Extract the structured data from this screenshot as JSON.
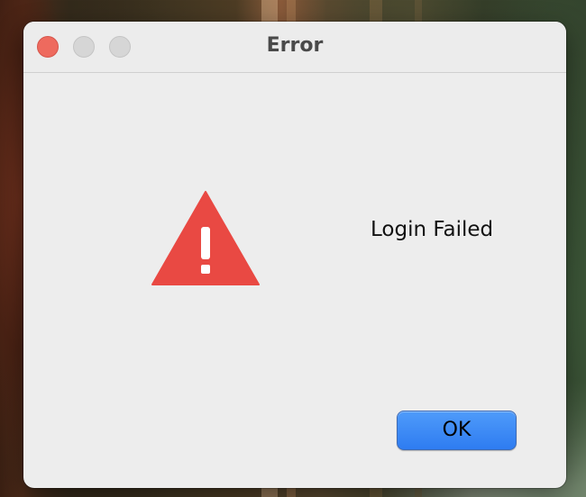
{
  "window": {
    "title": "Error"
  },
  "titlebar": {
    "buttons": [
      "close",
      "minimize",
      "zoom"
    ],
    "close_color": "#ee6a5e",
    "inactive_color": "#d6d6d6"
  },
  "dialog": {
    "icon": "warning-triangle-icon",
    "icon_color": "#e94943",
    "message": "Login Failed",
    "ok_label": "OK",
    "ok_color": "#3b86f7"
  }
}
